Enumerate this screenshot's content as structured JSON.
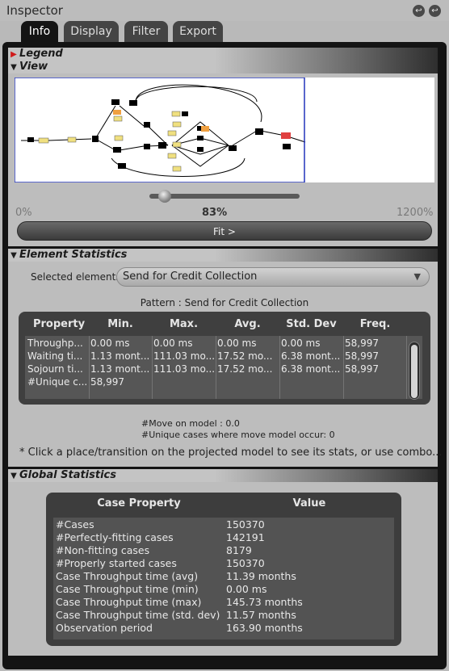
{
  "window": {
    "title": "Inspector",
    "btn1_glyph": "↩",
    "btn2_glyph": "↩"
  },
  "tabs": [
    "Info",
    "Display",
    "Filter",
    "Export"
  ],
  "sections": {
    "legend": "Legend",
    "view": "View",
    "element_stats": "Element Statistics",
    "global_stats": "Global Statistics"
  },
  "view": {
    "zoom_min": "0%",
    "zoom_current": "83%",
    "zoom_max": "1200%",
    "zoom_level": 0.069,
    "fit_label": "Fit >"
  },
  "element_stats": {
    "selected_label": "Selected elements*",
    "selected_value": "Send for Credit Collection",
    "pattern": "Pattern : Send for Credit Collection",
    "columns": [
      "Property",
      "Min.",
      "Max.",
      "Avg.",
      "Std. Dev",
      "Freq."
    ],
    "rows": [
      [
        "Throughp...",
        "0.00 ms",
        "0.00 ms",
        "0.00 ms",
        "0.00 ms",
        "58,997"
      ],
      [
        "Waiting ti...",
        "1.13 mont...",
        "111.03 mo...",
        "17.52 mo...",
        "6.38 mont...",
        "58,997"
      ],
      [
        "Sojourn ti...",
        "1.13 mont...",
        "111.03 mo...",
        "17.52 mo...",
        "6.38 mont...",
        "58,997"
      ],
      [
        "#Unique c...",
        "58,997",
        "",
        "",
        "",
        ""
      ]
    ],
    "move_on_model": "#Move on model : 0.0",
    "unique_cases": "#Unique cases where move model occur: 0",
    "hint": "* Click a place/transition on the projected model to see its stats, or use combo..."
  },
  "global_stats": {
    "columns": [
      "Case Property",
      "Value"
    ],
    "rows": [
      [
        "#Cases",
        "150370"
      ],
      [
        "#Perfectly-fitting cases",
        "142191"
      ],
      [
        "#Non-fitting cases",
        "8179"
      ],
      [
        "#Properly started cases",
        "150370"
      ],
      [
        "Case Throughput time (avg)",
        "11.39 months"
      ],
      [
        "Case Throughput time (min)",
        "0.00 ms"
      ],
      [
        "Case Throughput time (max)",
        "145.73 months"
      ],
      [
        "Case Throughput time (std. dev)",
        "11.57 months"
      ],
      [
        "Observation period",
        "163.90 months"
      ]
    ]
  }
}
